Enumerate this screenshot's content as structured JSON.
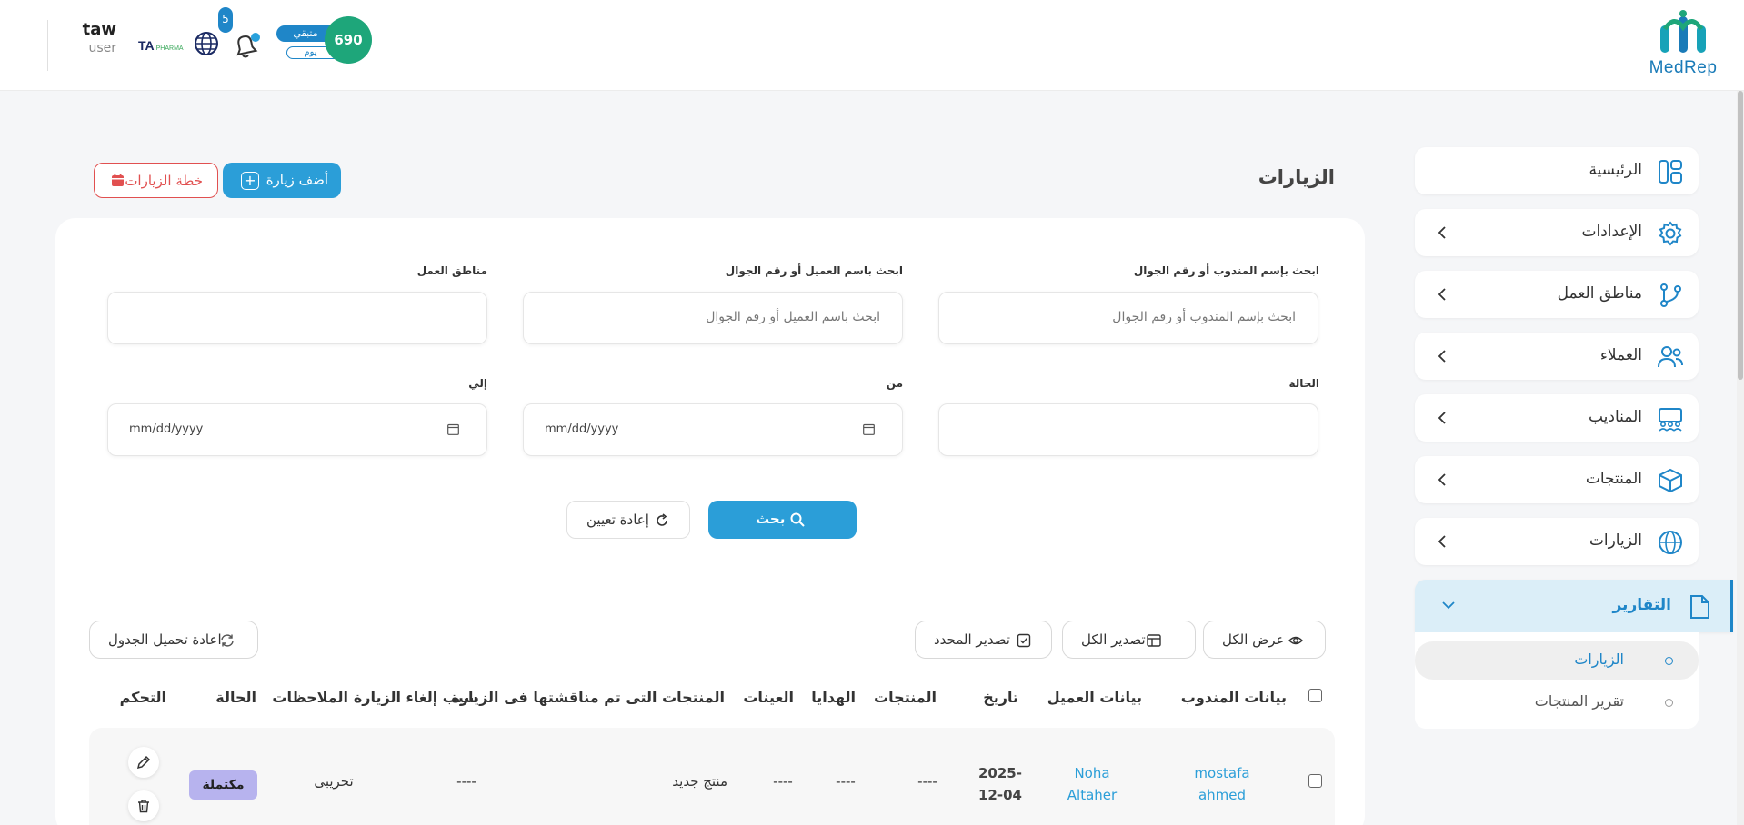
{
  "header": {
    "logo_text": "MedRep",
    "user_name": "taw",
    "user_role": "user",
    "brand": "TA",
    "brand_sub": "PHARMA",
    "notification_count": "5",
    "points": "690",
    "points_label": "متبقي",
    "points_period": "يوم"
  },
  "sidebar": {
    "items": [
      {
        "label": "الرئيسية",
        "icon": "dashboard-icon"
      },
      {
        "label": "الإعدادات",
        "icon": "gear-icon"
      },
      {
        "label": "مناطق العمل",
        "icon": "branch-icon"
      },
      {
        "label": "العملاء",
        "icon": "users-icon"
      },
      {
        "label": "المناديب",
        "icon": "team-icon"
      },
      {
        "label": "المنتجات",
        "icon": "box-icon"
      },
      {
        "label": "الزيارات",
        "icon": "globe-icon"
      },
      {
        "label": "التقارير",
        "icon": "document-icon"
      }
    ],
    "subitems": [
      {
        "label": "الزيارات",
        "active": true
      },
      {
        "label": "تقرير المنتجات",
        "active": false
      }
    ]
  },
  "page": {
    "title": "الزيارات",
    "add_visit": "أضف زيارة",
    "visit_plan": "خطة الزيارات"
  },
  "filters": {
    "rep_label": "ابحث بإسم المندوب أو رقم الجوال",
    "rep_placeholder": "ابحث بإسم المندوب أو رقم الجوال",
    "client_label": "ابحث باسم العميل أو رقم الجوال",
    "client_placeholder": "ابحث باسم العميل أو رقم الجوال",
    "zones_label": "مناطق العمل",
    "status_label": "الحالة",
    "from_label": "من",
    "from_value": "mm/dd/yyyy",
    "to_label": "إلي",
    "to_value": "mm/dd/yyyy",
    "search": "بحث",
    "reset": "إعادة تعيين"
  },
  "toolbar": {
    "show_all": "عرض الكل",
    "export_all": "تصدير الكل",
    "export_selected": "تصدير المحدد",
    "reload": "اعادة تحميل الجدول"
  },
  "table": {
    "headers": [
      "بيانات المندوب",
      "بيانات العميل",
      "تاريخ",
      "المنتجات",
      "الهدايا",
      "العينات",
      "المنتجات التى تم مناقشتها فى الزيارة",
      "سبب إلغاء الزيارة",
      "الملاحظات",
      "الحالة",
      "التحكم"
    ],
    "rows": [
      {
        "rep_line1": "mostafa",
        "rep_line2": "ahmed",
        "client_line1": "Noha",
        "client_line2": "Altaher",
        "date_line1": "2025-",
        "date_line2": "12-04",
        "products": "----",
        "gifts": "----",
        "samples": "----",
        "discussed": "منتج جديد",
        "cancel_reason": "----",
        "notes": "تحريبى",
        "status": "مكتملة"
      }
    ]
  },
  "colors": {
    "primary": "#2b9ed8",
    "danger": "#e15050",
    "status_complete": "#b7b3ee",
    "points": "#1ea67a"
  }
}
